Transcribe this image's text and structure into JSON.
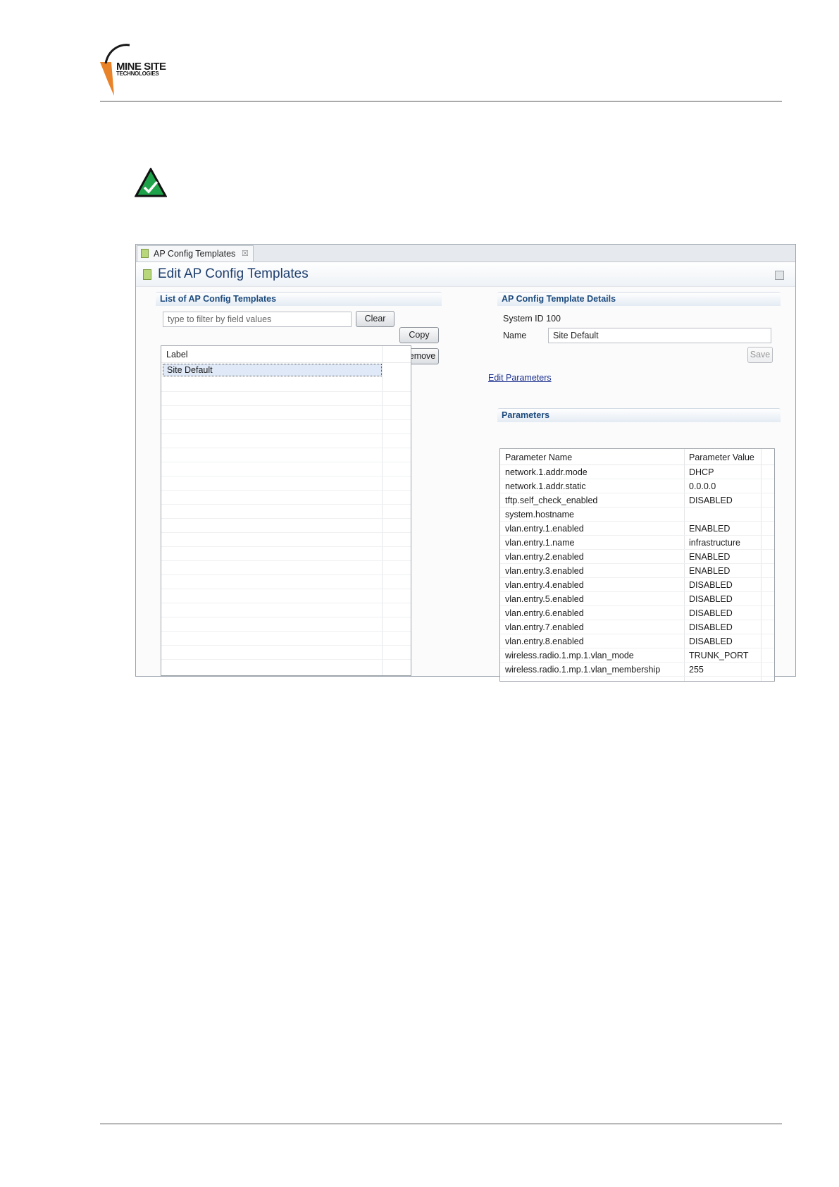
{
  "brand": {
    "line1": "MINE SITE",
    "line2": "TECHNOLOGIES"
  },
  "tab": {
    "label": "AP Config Templates",
    "close": "☒"
  },
  "view": {
    "title": "Edit AP Config Templates"
  },
  "left": {
    "section_title": "List of AP Config Templates",
    "filter_placeholder": "type to filter by field values",
    "clear_label": "Clear",
    "copy_label": "Copy",
    "remove_label": "Remove",
    "column_label": "Label",
    "selected_item": "Site Default"
  },
  "right": {
    "section_title": "AP Config Template Details",
    "system_id": "System ID  100",
    "name_label": "Name",
    "name_value": "Site Default",
    "save_label": "Save",
    "edit_link": "Edit Parameters ",
    "params_title": "Parameters",
    "params_headers": [
      "Parameter Name",
      "Parameter Value"
    ],
    "params": [
      {
        "name": "network.1.addr.mode",
        "value": "DHCP"
      },
      {
        "name": "network.1.addr.static",
        "value": "0.0.0.0"
      },
      {
        "name": "tftp.self_check_enabled",
        "value": "DISABLED"
      },
      {
        "name": "system.hostname",
        "value": ""
      },
      {
        "name": "vlan.entry.1.enabled",
        "value": "ENABLED"
      },
      {
        "name": "vlan.entry.1.name",
        "value": "infrastructure"
      },
      {
        "name": "vlan.entry.2.enabled",
        "value": "ENABLED"
      },
      {
        "name": "vlan.entry.3.enabled",
        "value": "ENABLED"
      },
      {
        "name": "vlan.entry.4.enabled",
        "value": "DISABLED"
      },
      {
        "name": "vlan.entry.5.enabled",
        "value": "DISABLED"
      },
      {
        "name": "vlan.entry.6.enabled",
        "value": "DISABLED"
      },
      {
        "name": "vlan.entry.7.enabled",
        "value": "DISABLED"
      },
      {
        "name": "vlan.entry.8.enabled",
        "value": "DISABLED"
      },
      {
        "name": "wireless.radio.1.mp.1.vlan_mode",
        "value": "TRUNK_PORT"
      },
      {
        "name": "wireless.radio.1.mp.1.vlan_membership",
        "value": "255"
      }
    ]
  }
}
